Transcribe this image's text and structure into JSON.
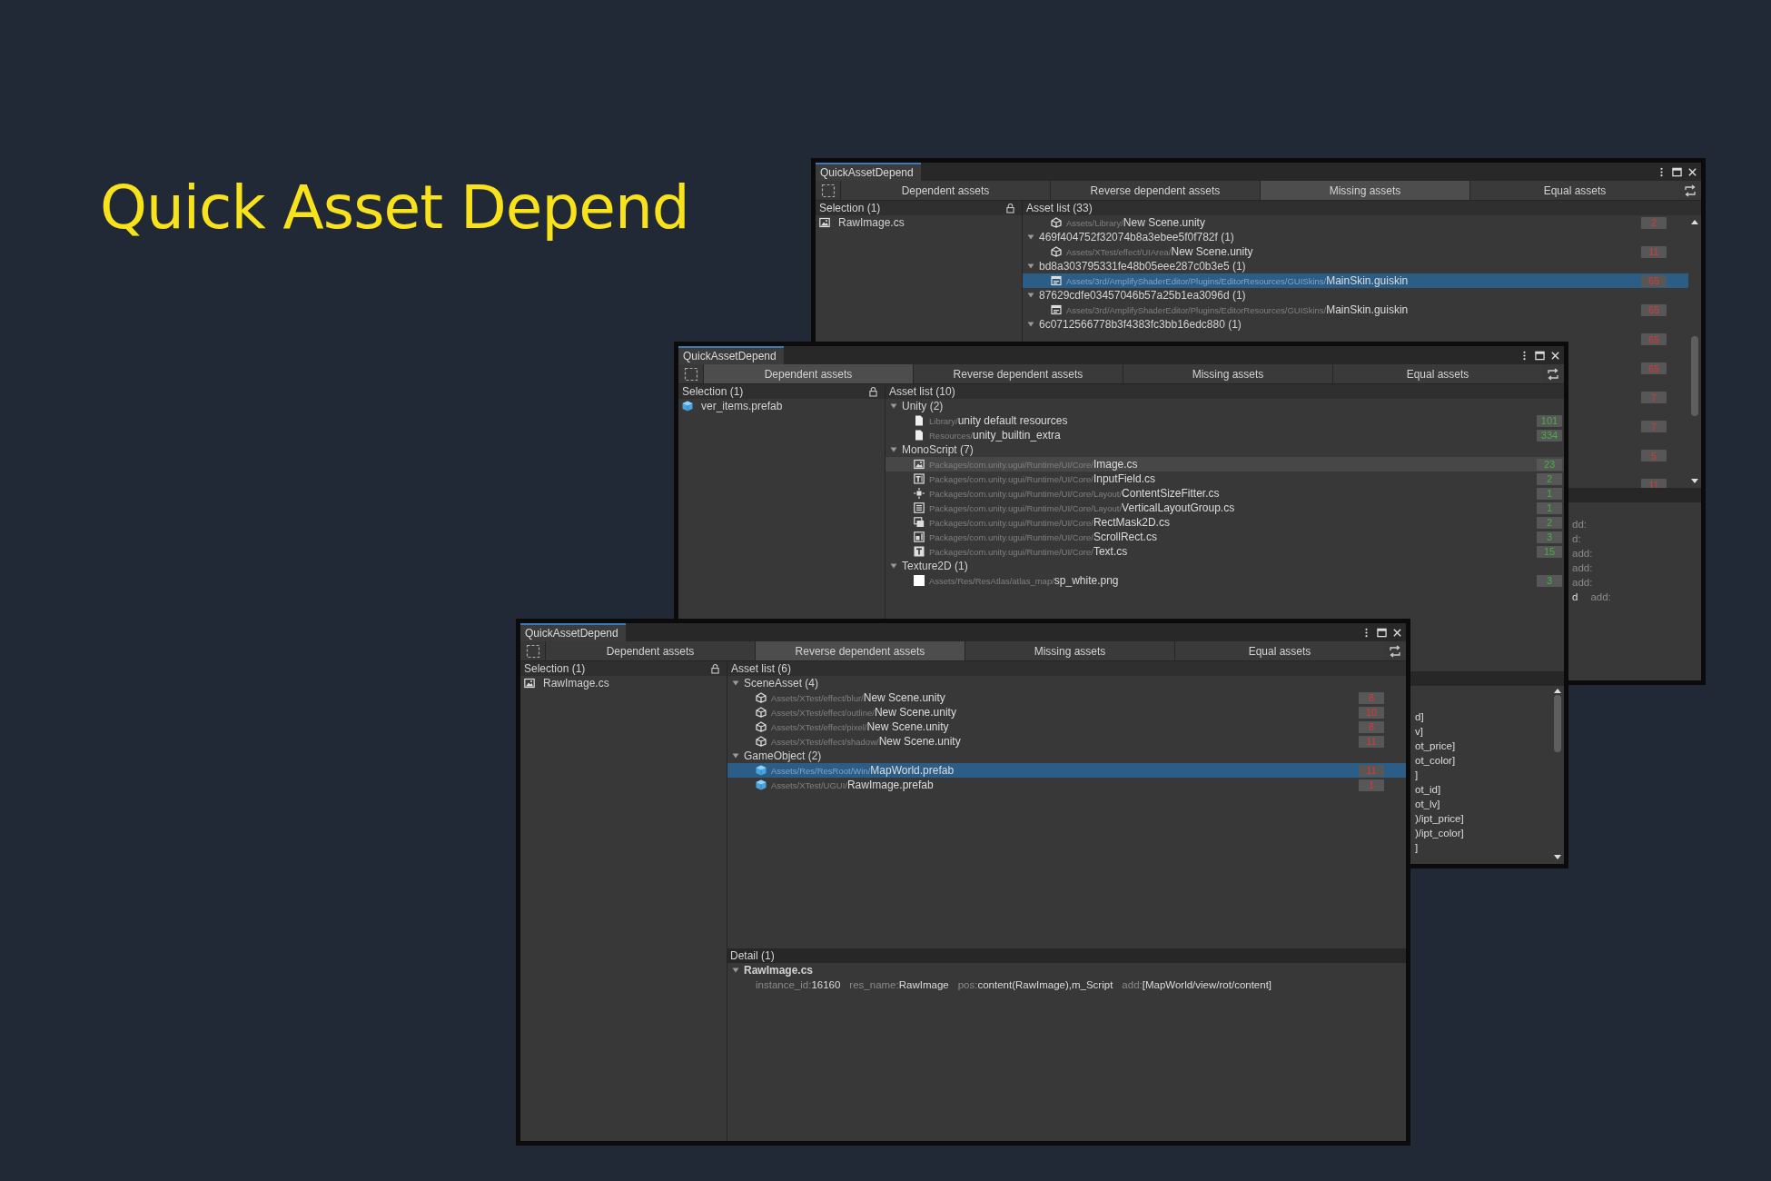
{
  "title": "Quick Asset Depend",
  "windows": [
    {
      "tab_title": "QuickAssetDepend",
      "tabs": [
        {
          "label": "Dependent assets",
          "selected": false
        },
        {
          "label": "Reverse dependent assets",
          "selected": false
        },
        {
          "label": "Missing assets",
          "selected": true
        },
        {
          "label": "Equal assets",
          "selected": false
        }
      ],
      "selection": {
        "title": "Selection (1)",
        "items": [
          {
            "kind": "image",
            "name": "RawImage.cs",
            "selected": false
          }
        ]
      },
      "asset_list": {
        "title": "Asset list (33)",
        "scrollbar": true,
        "rows": [
          {
            "kind": "scene",
            "path": "Assets/Library/",
            "name": "New Scene.unity",
            "count": "2",
            "selected": false,
            "hovered": false
          },
          {
            "kind": "group",
            "name": "469f404752f32074b8a3ebee5f0f782f (1)",
            "expanded": true
          },
          {
            "kind": "scene",
            "path": "Assets/XTest/effect/UIArea/",
            "name": "New Scene.unity",
            "count": "11",
            "selected": false,
            "hovered": false
          },
          {
            "kind": "group",
            "name": "bd8a303795331fe48b05eee287c0b3e5 (1)",
            "expanded": true
          },
          {
            "kind": "skin",
            "path": "Assets/3rd/AmplifyShaderEditor/Plugins/EditorResources/GUISkins/",
            "name": "MainSkin.guiskin",
            "count": "65",
            "selected": true,
            "hovered": false
          },
          {
            "kind": "group",
            "name": "87629cdfe03457046b57a25b1ea3096d (1)",
            "expanded": true
          },
          {
            "kind": "skin",
            "path": "Assets/3rd/AmplifyShaderEditor/Plugins/EditorResources/GUISkins/",
            "name": "MainSkin.guiskin",
            "count": "65",
            "selected": false,
            "hovered": false
          },
          {
            "kind": "group",
            "name": "6c0712566778b3f4383fc3bb16edc880 (1)",
            "expanded": true
          },
          {
            "kind": "badge",
            "count": "65"
          },
          {
            "kind": "covered",
            "count": "65"
          },
          {
            "kind": "covered",
            "count": "7"
          },
          {
            "kind": "covered",
            "count": "7"
          },
          {
            "kind": "covered",
            "count": "5"
          },
          {
            "kind": "covered",
            "count": "11"
          }
        ]
      },
      "detail": {
        "lines": [
          {
            "parts": [
              {
                "text": "dd:",
                "dim": true
              }
            ]
          },
          {
            "parts": [
              {
                "text": "d:",
                "dim": true
              }
            ]
          },
          {
            "parts": [
              {
                "text": "add:",
                "dim": true
              }
            ]
          },
          {
            "parts": [
              {
                "text": "add:",
                "dim": true
              }
            ]
          },
          {
            "parts": [
              {
                "text": "add:",
                "dim": true
              }
            ]
          },
          {
            "parts": [
              {
                "text": "d",
                "dim": false
              },
              {
                "text": "add:",
                "dim": true
              }
            ]
          }
        ]
      }
    },
    {
      "tab_title": "QuickAssetDepend",
      "tabs": [
        {
          "label": "Dependent assets",
          "selected": true
        },
        {
          "label": "Reverse dependent assets",
          "selected": false
        },
        {
          "label": "Missing assets",
          "selected": false
        },
        {
          "label": "Equal assets",
          "selected": false
        }
      ],
      "selection": {
        "title": "Selection (1)",
        "items": [
          {
            "kind": "prefab",
            "name": "ver_items.prefab",
            "selected": false
          }
        ]
      },
      "asset_list": {
        "title": "Asset list (10)",
        "rows": [
          {
            "kind": "group",
            "name": "Unity (2)",
            "expanded": true
          },
          {
            "kind": "file",
            "path": "Library/",
            "name": "unity default resources",
            "count": "101",
            "selected": false,
            "hovered": false
          },
          {
            "kind": "file",
            "path": "Resources/",
            "name": "unity_builtin_extra",
            "count": "334",
            "selected": false,
            "hovered": false
          },
          {
            "kind": "group",
            "name": "MonoScript (7)",
            "expanded": true
          },
          {
            "kind": "image",
            "path": "Packages/com.unity.ugui/Runtime/UI/Core/",
            "name": "Image.cs",
            "count": "23",
            "selected": false,
            "hovered": true
          },
          {
            "kind": "inputfield",
            "path": "Packages/com.unity.ugui/Runtime/UI/Core/",
            "name": "InputField.cs",
            "count": "2",
            "selected": false,
            "hovered": false
          },
          {
            "kind": "fitter",
            "path": "Packages/com.unity.ugui/Runtime/UI/Core/Layout/",
            "name": "ContentSizeFitter.cs",
            "count": "1",
            "selected": false,
            "hovered": false
          },
          {
            "kind": "layout",
            "path": "Packages/com.unity.ugui/Runtime/UI/Core/Layout/",
            "name": "VerticalLayoutGroup.cs",
            "count": "1",
            "selected": false,
            "hovered": false
          },
          {
            "kind": "mask",
            "path": "Packages/com.unity.ugui/Runtime/UI/Core/",
            "name": "RectMask2D.cs",
            "count": "2",
            "selected": false,
            "hovered": false
          },
          {
            "kind": "scroll",
            "path": "Packages/com.unity.ugui/Runtime/UI/Core/",
            "name": "ScrollRect.cs",
            "count": "3",
            "selected": false,
            "hovered": false
          },
          {
            "kind": "text",
            "path": "Packages/com.unity.ugui/Runtime/UI/Core/",
            "name": "Text.cs",
            "count": "15",
            "selected": false,
            "hovered": false
          },
          {
            "kind": "group",
            "name": "Texture2D (1)",
            "expanded": true
          },
          {
            "kind": "texture",
            "path": "Assets/Res/ResAtlas/atlas_map/",
            "name": "sp_white.png",
            "count": "3",
            "selected": false,
            "hovered": false
          }
        ]
      },
      "detail": {
        "scrollbar": true,
        "lines": [
          {
            "parts": [
              {
                "text": "d]",
                "dim": false
              }
            ]
          },
          {
            "parts": [
              {
                "text": "v]",
                "dim": false
              }
            ]
          },
          {
            "parts": [
              {
                "text": "ot_price]",
                "dim": false
              }
            ]
          },
          {
            "parts": [
              {
                "text": "ot_color]",
                "dim": false
              }
            ]
          },
          {
            "parts": [
              {
                "text": "]",
                "dim": false
              }
            ]
          },
          {
            "parts": [
              {
                "text": "ot_id]",
                "dim": false
              }
            ]
          },
          {
            "parts": [
              {
                "text": "ot_lv]",
                "dim": false
              }
            ]
          },
          {
            "parts": [
              {
                "text": ")/ipt_price]",
                "dim": false
              }
            ]
          },
          {
            "parts": [
              {
                "text": ")/ipt_color]",
                "dim": false
              }
            ]
          },
          {
            "parts": [
              {
                "text": "]",
                "dim": false
              }
            ]
          }
        ]
      }
    },
    {
      "tab_title": "QuickAssetDepend",
      "tabs": [
        {
          "label": "Dependent assets",
          "selected": false
        },
        {
          "label": "Reverse dependent assets",
          "selected": true
        },
        {
          "label": "Missing assets",
          "selected": false
        },
        {
          "label": "Equal assets",
          "selected": false
        }
      ],
      "selection": {
        "title": "Selection (1)",
        "items": [
          {
            "kind": "image",
            "name": "RawImage.cs",
            "selected": false
          }
        ]
      },
      "asset_list": {
        "title": "Asset list (6)",
        "rows": [
          {
            "kind": "group",
            "name": "SceneAsset (4)",
            "expanded": true
          },
          {
            "kind": "scene",
            "path": "Assets/XTest/effect/blur/",
            "name": "New Scene.unity",
            "count": "8",
            "selected": false,
            "hovered": false
          },
          {
            "kind": "scene",
            "path": "Assets/XTest/effect/outline/",
            "name": "New Scene.unity",
            "count": "10",
            "selected": false,
            "hovered": false
          },
          {
            "kind": "scene",
            "path": "Assets/XTest/effect/pixel/",
            "name": "New Scene.unity",
            "count": "8",
            "selected": false,
            "hovered": false
          },
          {
            "kind": "scene",
            "path": "Assets/XTest/effect/shadow/",
            "name": "New Scene.unity",
            "count": "11",
            "selected": false,
            "hovered": false
          },
          {
            "kind": "group",
            "name": "GameObject (2)",
            "expanded": true
          },
          {
            "kind": "prefab",
            "path": "Assets/Res/ResRoot/Win/",
            "name": "MapWorld.prefab",
            "count": "11",
            "selected": true,
            "hovered": false
          },
          {
            "kind": "prefab",
            "path": "Assets/XTest/UGUI/",
            "name": "RawImage.prefab",
            "count": "1",
            "selected": false,
            "hovered": false
          }
        ]
      },
      "detail": {
        "title": "Detail (1)",
        "groups": [
          {
            "name": "RawImage.cs",
            "expanded": true,
            "lines": [
              {
                "parts": [
                  {
                    "text": "instance_id:",
                    "dim": true
                  },
                  {
                    "text": "16160",
                    "dim": false
                  },
                  {
                    "text": "res_name:",
                    "dim": true
                  },
                  {
                    "text": "RawImage",
                    "dim": false
                  },
                  {
                    "text": "pos:",
                    "dim": true
                  },
                  {
                    "text": "content(RawImage),m_Script",
                    "dim": false
                  },
                  {
                    "text": "add:",
                    "dim": true
                  },
                  {
                    "text": "[MapWorld/view/rot/content]",
                    "dim": false
                  }
                ]
              }
            ]
          }
        ]
      }
    }
  ]
}
